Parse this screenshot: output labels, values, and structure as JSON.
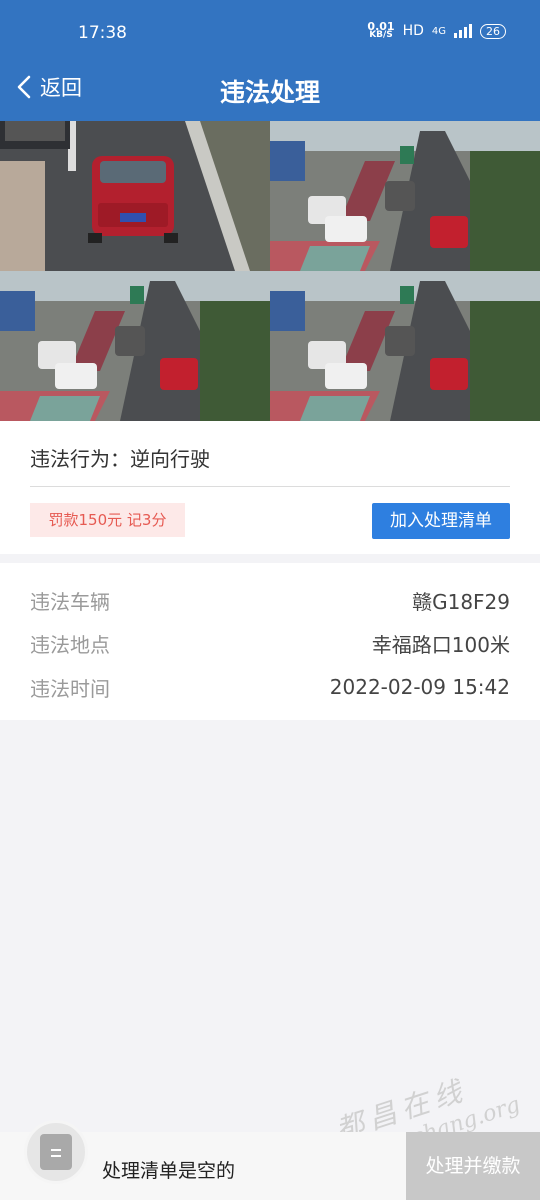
{
  "status_bar": {
    "time": "17:38",
    "net_speed_value": "0.01",
    "net_speed_unit": "KB/S",
    "hd": "HD",
    "network": "4G",
    "battery": "26"
  },
  "nav": {
    "back_label": "返回",
    "title": "违法处理"
  },
  "photos": {
    "count": 4,
    "plate_text": "赣G18F29"
  },
  "violation": {
    "behavior": "违法行为：逆向行驶",
    "fine_badge": "罚款150元 记3分",
    "add_button": "加入处理清单"
  },
  "details": {
    "rows": [
      {
        "label": "违法车辆",
        "value": "赣G18F29"
      },
      {
        "label": "违法地点",
        "value": "幸福路口100米"
      },
      {
        "label": "违法时间",
        "value": "2022-02-09 15:42"
      }
    ]
  },
  "bottom_bar": {
    "empty_text": "处理清单是空的",
    "pay_button": "处理并缴款"
  },
  "watermark": {
    "text_cn": "都昌在线",
    "text_url": "www.duchang.org"
  },
  "colors": {
    "header_bg": "#3374c1",
    "primary_button": "#2e7fe0",
    "fine_badge_bg": "#fde9e8",
    "fine_badge_text": "#e65a52",
    "disabled_button": "#c8c8c8"
  }
}
